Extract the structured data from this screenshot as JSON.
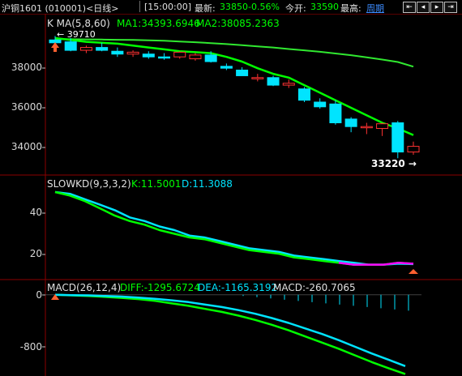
{
  "topbar": {
    "title": "沪铜1601 (010001)<日线>",
    "time": "[15:00:00]",
    "latest_label": "最新:",
    "latest_value": "33850",
    "change": "-0.56%",
    "open_label": "今开:",
    "open_value": "33590",
    "high_label": "最高:",
    "period_link": "周期"
  },
  "kpanel": {
    "indicator": "K  MA(5,8,60)",
    "ma1": "MA1:34393.6946",
    "ma2": "MA2:38085.2363",
    "high_mark": "← 39710",
    "low_mark": "33220 →",
    "yticks": [
      "38000",
      "36000",
      "34000"
    ]
  },
  "kdpanel": {
    "indicator": "SLOWKD(9,3,3,2)",
    "k": "K:11.5001",
    "d": "D:11.3088",
    "yticks": [
      "40",
      "20"
    ]
  },
  "macdpanel": {
    "indicator": "MACD(26,12,4)",
    "diff": "DIFF:-1295.6724",
    "dea": "DEA:-1165.3192",
    "macd": "MACD:-260.7065",
    "yticks": [
      "0",
      "-800"
    ]
  },
  "colors": {
    "up": "#ff3232",
    "down": "#00e4ff",
    "ma_short": "#00ff00",
    "ma_long": "#30e830",
    "kline": "#ffffff",
    "magenta": "#ff00ff",
    "panel_border": "#8b0000"
  },
  "chart_data": {
    "type": "candlestick",
    "y_range": [
      32800,
      39900
    ],
    "candles": [
      {
        "o": 39500,
        "h": 39710,
        "l": 39300,
        "c": 39350
      },
      {
        "o": 39400,
        "h": 39600,
        "l": 38900,
        "c": 38950
      },
      {
        "o": 38950,
        "h": 39200,
        "l": 38800,
        "c": 39100
      },
      {
        "o": 39100,
        "h": 39350,
        "l": 38900,
        "c": 38950
      },
      {
        "o": 38900,
        "h": 39100,
        "l": 38600,
        "c": 38750
      },
      {
        "o": 38750,
        "h": 38950,
        "l": 38600,
        "c": 38850
      },
      {
        "o": 38750,
        "h": 38900,
        "l": 38500,
        "c": 38600
      },
      {
        "o": 38600,
        "h": 38800,
        "l": 38450,
        "c": 38550
      },
      {
        "o": 38600,
        "h": 38900,
        "l": 38500,
        "c": 38850
      },
      {
        "o": 38500,
        "h": 38800,
        "l": 38400,
        "c": 38700
      },
      {
        "o": 38700,
        "h": 38900,
        "l": 38300,
        "c": 38350
      },
      {
        "o": 38100,
        "h": 38250,
        "l": 37900,
        "c": 38000
      },
      {
        "o": 37900,
        "h": 38050,
        "l": 37600,
        "c": 37600
      },
      {
        "o": 37500,
        "h": 37700,
        "l": 37300,
        "c": 37500
      },
      {
        "o": 37500,
        "h": 37600,
        "l": 37050,
        "c": 37100
      },
      {
        "o": 37100,
        "h": 37400,
        "l": 36950,
        "c": 37200
      },
      {
        "o": 36900,
        "h": 37000,
        "l": 36200,
        "c": 36300
      },
      {
        "o": 36200,
        "h": 36400,
        "l": 35850,
        "c": 35950
      },
      {
        "o": 36100,
        "h": 36300,
        "l": 35000,
        "c": 35100
      },
      {
        "o": 35300,
        "h": 35400,
        "l": 34600,
        "c": 34900
      },
      {
        "o": 34900,
        "h": 35100,
        "l": 34500,
        "c": 34900
      },
      {
        "o": 34800,
        "h": 35100,
        "l": 34400,
        "c": 35050
      },
      {
        "o": 35100,
        "h": 35200,
        "l": 33220,
        "c": 33550
      },
      {
        "o": 33550,
        "h": 34100,
        "l": 33400,
        "c": 33850
      }
    ],
    "ma_short": [
      39600,
      39500,
      39400,
      39350,
      39300,
      39200,
      39100,
      39000,
      38900,
      38850,
      38800,
      38600,
      38350,
      38000,
      37700,
      37500,
      37100,
      36700,
      36300,
      35900,
      35500,
      35100,
      34800,
      34450
    ],
    "ma_long": [
      39550,
      39540,
      39530,
      39520,
      39510,
      39500,
      39480,
      39460,
      39420,
      39380,
      39330,
      39280,
      39220,
      39160,
      39100,
      39020,
      38950,
      38870,
      38780,
      38690,
      38580,
      38460,
      38330,
      38085
    ],
    "kd": {
      "y_range": [
        5,
        55
      ],
      "k": [
        51,
        49,
        46,
        42,
        38,
        35,
        33,
        30,
        28,
        26,
        25,
        23,
        21,
        19,
        18,
        17,
        15,
        14,
        13,
        12,
        11,
        11,
        11,
        12,
        11.5
      ],
      "d": [
        51,
        50,
        47,
        44,
        41,
        37,
        35,
        32,
        30,
        27,
        26,
        24,
        22,
        20,
        19,
        18,
        16,
        15,
        14,
        13,
        12,
        11,
        11,
        11.5,
        11.3
      ]
    },
    "macd": {
      "y_range": [
        -1300,
        50
      ],
      "diff": [
        0,
        -10,
        -20,
        -35,
        -50,
        -70,
        -100,
        -140,
        -180,
        -230,
        -280,
        -340,
        -410,
        -490,
        -580,
        -680,
        -780,
        -880,
        -990,
        -1100,
        -1200,
        -1295
      ],
      "dea": [
        0,
        -5,
        -10,
        -20,
        -30,
        -45,
        -65,
        -90,
        -120,
        -160,
        -200,
        -250,
        -310,
        -380,
        -460,
        -550,
        -640,
        -740,
        -850,
        -960,
        -1060,
        -1165
      ],
      "bars": [
        -20,
        -40,
        -60,
        -80,
        -100,
        -120,
        -140,
        -160,
        -180,
        -200,
        -220,
        -240,
        -260
      ]
    }
  }
}
